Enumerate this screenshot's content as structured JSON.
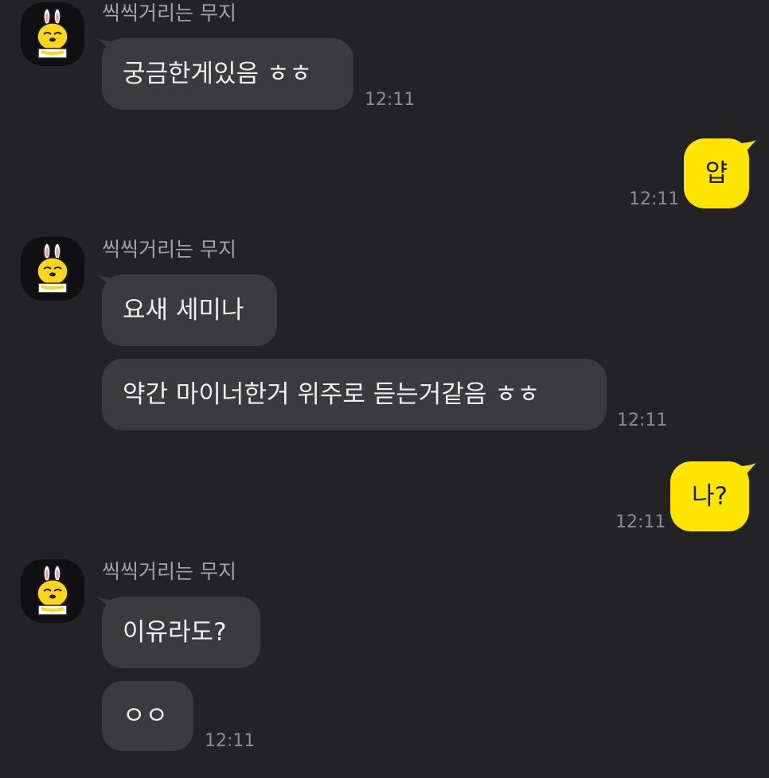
{
  "chat": {
    "sender_name": "씩씩거리는 무지",
    "colors": {
      "background": "#232325",
      "incoming_bubble": "#3b3b3d",
      "outgoing_bubble": "#fee500",
      "avatar_bg": "#101012"
    },
    "groups": [
      {
        "sender": "씩씩거리는 무지",
        "avatar_icon": "muzi-character-icon",
        "messages": [
          "궁금한게있음 ㅎㅎ"
        ],
        "time": "12:11"
      },
      {
        "outgoing": true,
        "messages": [
          "얍"
        ],
        "time": "12:11"
      },
      {
        "sender": "씩씩거리는 무지",
        "avatar_icon": "muzi-character-icon",
        "messages": [
          "요새 세미나",
          "약간 마이너한거 위주로 듣는거같음 ㅎㅎ"
        ],
        "time": "12:11"
      },
      {
        "outgoing": true,
        "messages": [
          "나?"
        ],
        "time": "12:11"
      },
      {
        "sender": "씩씩거리는 무지",
        "avatar_icon": "muzi-character-icon",
        "messages": [
          "이유라도?",
          "ㅇㅇ"
        ],
        "time": "12:11"
      }
    ]
  }
}
